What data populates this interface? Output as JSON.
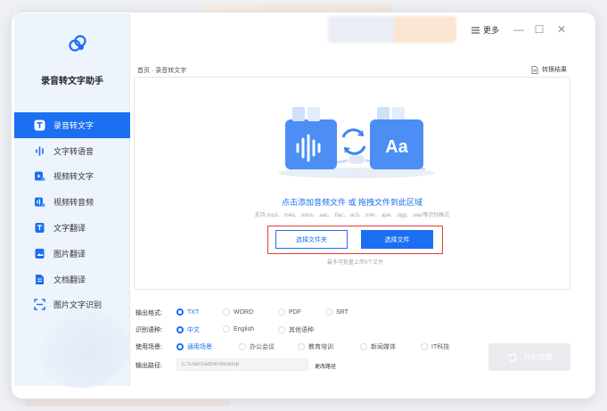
{
  "app": {
    "name": "录音转文字助手"
  },
  "titlebar": {
    "more_label": "更多",
    "minimize": "—",
    "maximize": "☐",
    "close": "✕"
  },
  "sidebar": {
    "items": [
      {
        "label": "录音转文字",
        "icon": "text-t-icon",
        "active": true
      },
      {
        "label": "文字转语音",
        "icon": "audio-wave-icon",
        "active": false
      },
      {
        "label": "视频转文字",
        "icon": "video-text-icon",
        "active": false
      },
      {
        "label": "视频转音频",
        "icon": "video-audio-icon",
        "active": false
      },
      {
        "label": "文字翻译",
        "icon": "text-translate-icon",
        "active": false
      },
      {
        "label": "图片翻译",
        "icon": "image-translate-icon",
        "active": false
      },
      {
        "label": "文档翻译",
        "icon": "document-translate-icon",
        "active": false
      },
      {
        "label": "图片文字识别",
        "icon": "scan-icon",
        "active": false
      }
    ]
  },
  "main": {
    "breadcrumb": "首页 · 录音转文字",
    "result_label": "转换结果",
    "drop_title": "点击添加音频文件 或 拖拽文件到此区域",
    "formats": "支持.mp3、.m4a、.wma、.aac、.flac、.ac3、.m4r、.ape、.ogg、.wav等识别格式",
    "select_folder_label": "选择文件夹",
    "select_file_label": "选择文件",
    "limit_note": "最多可批量上传6个文件"
  },
  "options": {
    "format": {
      "label": "输出格式:",
      "choices": [
        "TXT",
        "WORD",
        "PDF",
        "SRT"
      ],
      "selected": "TXT"
    },
    "language": {
      "label": "识别语种:",
      "choices": [
        "中文",
        "English",
        "其他语种"
      ],
      "selected": "中文"
    },
    "scene": {
      "label": "使用场景:",
      "choices": [
        "通用场景",
        "办公会议",
        "教育培训",
        "新闻媒体",
        "IT科技"
      ],
      "selected": "通用场景"
    },
    "path": {
      "label": "输出路径:",
      "value": "C:\\Users\\admin\\desktop",
      "change_label": "更改路径"
    }
  },
  "start_label": "开始转换",
  "colors": {
    "accent": "#1b6ff0",
    "highlight": "#e53935"
  }
}
